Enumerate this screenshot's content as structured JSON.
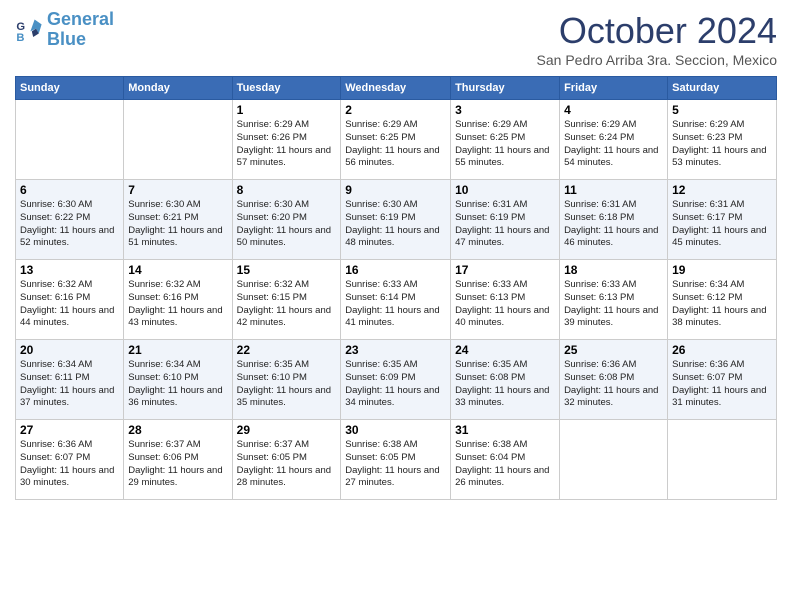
{
  "header": {
    "logo_line1": "General",
    "logo_line2": "Blue",
    "month": "October 2024",
    "location": "San Pedro Arriba 3ra. Seccion, Mexico"
  },
  "weekdays": [
    "Sunday",
    "Monday",
    "Tuesday",
    "Wednesday",
    "Thursday",
    "Friday",
    "Saturday"
  ],
  "weeks": [
    [
      {
        "day": "",
        "sunrise": "",
        "sunset": "",
        "daylight": ""
      },
      {
        "day": "",
        "sunrise": "",
        "sunset": "",
        "daylight": ""
      },
      {
        "day": "1",
        "sunrise": "Sunrise: 6:29 AM",
        "sunset": "Sunset: 6:26 PM",
        "daylight": "Daylight: 11 hours and 57 minutes."
      },
      {
        "day": "2",
        "sunrise": "Sunrise: 6:29 AM",
        "sunset": "Sunset: 6:25 PM",
        "daylight": "Daylight: 11 hours and 56 minutes."
      },
      {
        "day": "3",
        "sunrise": "Sunrise: 6:29 AM",
        "sunset": "Sunset: 6:25 PM",
        "daylight": "Daylight: 11 hours and 55 minutes."
      },
      {
        "day": "4",
        "sunrise": "Sunrise: 6:29 AM",
        "sunset": "Sunset: 6:24 PM",
        "daylight": "Daylight: 11 hours and 54 minutes."
      },
      {
        "day": "5",
        "sunrise": "Sunrise: 6:29 AM",
        "sunset": "Sunset: 6:23 PM",
        "daylight": "Daylight: 11 hours and 53 minutes."
      }
    ],
    [
      {
        "day": "6",
        "sunrise": "Sunrise: 6:30 AM",
        "sunset": "Sunset: 6:22 PM",
        "daylight": "Daylight: 11 hours and 52 minutes."
      },
      {
        "day": "7",
        "sunrise": "Sunrise: 6:30 AM",
        "sunset": "Sunset: 6:21 PM",
        "daylight": "Daylight: 11 hours and 51 minutes."
      },
      {
        "day": "8",
        "sunrise": "Sunrise: 6:30 AM",
        "sunset": "Sunset: 6:20 PM",
        "daylight": "Daylight: 11 hours and 50 minutes."
      },
      {
        "day": "9",
        "sunrise": "Sunrise: 6:30 AM",
        "sunset": "Sunset: 6:19 PM",
        "daylight": "Daylight: 11 hours and 48 minutes."
      },
      {
        "day": "10",
        "sunrise": "Sunrise: 6:31 AM",
        "sunset": "Sunset: 6:19 PM",
        "daylight": "Daylight: 11 hours and 47 minutes."
      },
      {
        "day": "11",
        "sunrise": "Sunrise: 6:31 AM",
        "sunset": "Sunset: 6:18 PM",
        "daylight": "Daylight: 11 hours and 46 minutes."
      },
      {
        "day": "12",
        "sunrise": "Sunrise: 6:31 AM",
        "sunset": "Sunset: 6:17 PM",
        "daylight": "Daylight: 11 hours and 45 minutes."
      }
    ],
    [
      {
        "day": "13",
        "sunrise": "Sunrise: 6:32 AM",
        "sunset": "Sunset: 6:16 PM",
        "daylight": "Daylight: 11 hours and 44 minutes."
      },
      {
        "day": "14",
        "sunrise": "Sunrise: 6:32 AM",
        "sunset": "Sunset: 6:16 PM",
        "daylight": "Daylight: 11 hours and 43 minutes."
      },
      {
        "day": "15",
        "sunrise": "Sunrise: 6:32 AM",
        "sunset": "Sunset: 6:15 PM",
        "daylight": "Daylight: 11 hours and 42 minutes."
      },
      {
        "day": "16",
        "sunrise": "Sunrise: 6:33 AM",
        "sunset": "Sunset: 6:14 PM",
        "daylight": "Daylight: 11 hours and 41 minutes."
      },
      {
        "day": "17",
        "sunrise": "Sunrise: 6:33 AM",
        "sunset": "Sunset: 6:13 PM",
        "daylight": "Daylight: 11 hours and 40 minutes."
      },
      {
        "day": "18",
        "sunrise": "Sunrise: 6:33 AM",
        "sunset": "Sunset: 6:13 PM",
        "daylight": "Daylight: 11 hours and 39 minutes."
      },
      {
        "day": "19",
        "sunrise": "Sunrise: 6:34 AM",
        "sunset": "Sunset: 6:12 PM",
        "daylight": "Daylight: 11 hours and 38 minutes."
      }
    ],
    [
      {
        "day": "20",
        "sunrise": "Sunrise: 6:34 AM",
        "sunset": "Sunset: 6:11 PM",
        "daylight": "Daylight: 11 hours and 37 minutes."
      },
      {
        "day": "21",
        "sunrise": "Sunrise: 6:34 AM",
        "sunset": "Sunset: 6:10 PM",
        "daylight": "Daylight: 11 hours and 36 minutes."
      },
      {
        "day": "22",
        "sunrise": "Sunrise: 6:35 AM",
        "sunset": "Sunset: 6:10 PM",
        "daylight": "Daylight: 11 hours and 35 minutes."
      },
      {
        "day": "23",
        "sunrise": "Sunrise: 6:35 AM",
        "sunset": "Sunset: 6:09 PM",
        "daylight": "Daylight: 11 hours and 34 minutes."
      },
      {
        "day": "24",
        "sunrise": "Sunrise: 6:35 AM",
        "sunset": "Sunset: 6:08 PM",
        "daylight": "Daylight: 11 hours and 33 minutes."
      },
      {
        "day": "25",
        "sunrise": "Sunrise: 6:36 AM",
        "sunset": "Sunset: 6:08 PM",
        "daylight": "Daylight: 11 hours and 32 minutes."
      },
      {
        "day": "26",
        "sunrise": "Sunrise: 6:36 AM",
        "sunset": "Sunset: 6:07 PM",
        "daylight": "Daylight: 11 hours and 31 minutes."
      }
    ],
    [
      {
        "day": "27",
        "sunrise": "Sunrise: 6:36 AM",
        "sunset": "Sunset: 6:07 PM",
        "daylight": "Daylight: 11 hours and 30 minutes."
      },
      {
        "day": "28",
        "sunrise": "Sunrise: 6:37 AM",
        "sunset": "Sunset: 6:06 PM",
        "daylight": "Daylight: 11 hours and 29 minutes."
      },
      {
        "day": "29",
        "sunrise": "Sunrise: 6:37 AM",
        "sunset": "Sunset: 6:05 PM",
        "daylight": "Daylight: 11 hours and 28 minutes."
      },
      {
        "day": "30",
        "sunrise": "Sunrise: 6:38 AM",
        "sunset": "Sunset: 6:05 PM",
        "daylight": "Daylight: 11 hours and 27 minutes."
      },
      {
        "day": "31",
        "sunrise": "Sunrise: 6:38 AM",
        "sunset": "Sunset: 6:04 PM",
        "daylight": "Daylight: 11 hours and 26 minutes."
      },
      {
        "day": "",
        "sunrise": "",
        "sunset": "",
        "daylight": ""
      },
      {
        "day": "",
        "sunrise": "",
        "sunset": "",
        "daylight": ""
      }
    ]
  ]
}
